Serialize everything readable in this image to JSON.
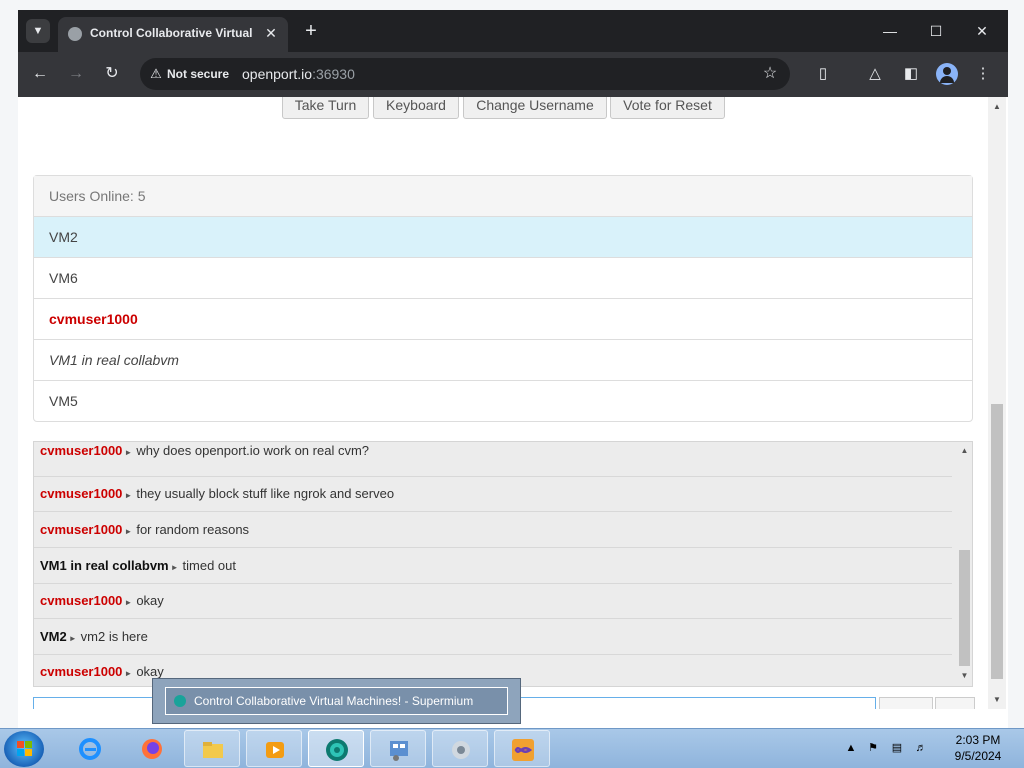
{
  "browser": {
    "tab_title": "Control Collaborative Virtual Machines! - Supermium",
    "tab_close_icon": "close-icon",
    "new_tab_icon": "plus-icon",
    "window_controls": [
      "minimize-icon",
      "maximize-icon",
      "close-icon"
    ],
    "security_label": "Not secure",
    "url_host": "openport.io",
    "url_port": ":36930"
  },
  "vm_controls": {
    "take_turn": "Take Turn",
    "keyboard": "Keyboard",
    "change_username": "Change Username",
    "vote_reset": "Vote for Reset"
  },
  "users": {
    "header": "Users Online: 5",
    "list": [
      {
        "name": "VM2",
        "style": "selected"
      },
      {
        "name": "VM6",
        "style": "normal"
      },
      {
        "name": "cvmuser1000",
        "style": "red"
      },
      {
        "name": "VM1 in real collabvm",
        "style": "italic"
      },
      {
        "name": "VM5",
        "style": "normal"
      }
    ]
  },
  "chat": {
    "messages": [
      {
        "user": "cvmuser1000",
        "color": "red",
        "text": "why does openport.io work on real cvm?"
      },
      {
        "user": "cvmuser1000",
        "color": "red",
        "text": "they usually block stuff like ngrok and serveo"
      },
      {
        "user": "cvmuser1000",
        "color": "red",
        "text": "for random reasons"
      },
      {
        "user": "VM1 in real collabvm",
        "color": "black",
        "text": "timed out"
      },
      {
        "user": "cvmuser1000",
        "color": "red",
        "text": "okay"
      },
      {
        "user": "VM2",
        "color": "black",
        "text": "vm2 is here"
      },
      {
        "user": "cvmuser1000",
        "color": "red",
        "text": "okay"
      }
    ]
  },
  "taskbar": {
    "tooltip": "Control Collaborative Virtual Machines! - Supermium",
    "clock_time": "2:03 PM",
    "clock_date": "9/5/2024",
    "apps": [
      "internet-explorer-icon",
      "firefox-icon",
      "file-explorer-icon",
      "media-player-icon",
      "supermium-icon",
      "control-panel-icon",
      "app-icon",
      "visual-studio-icon"
    ]
  },
  "colors": {
    "user_red": "#cc0000",
    "selected_row": "#d9f2fa",
    "chrome_dark": "#202124"
  }
}
